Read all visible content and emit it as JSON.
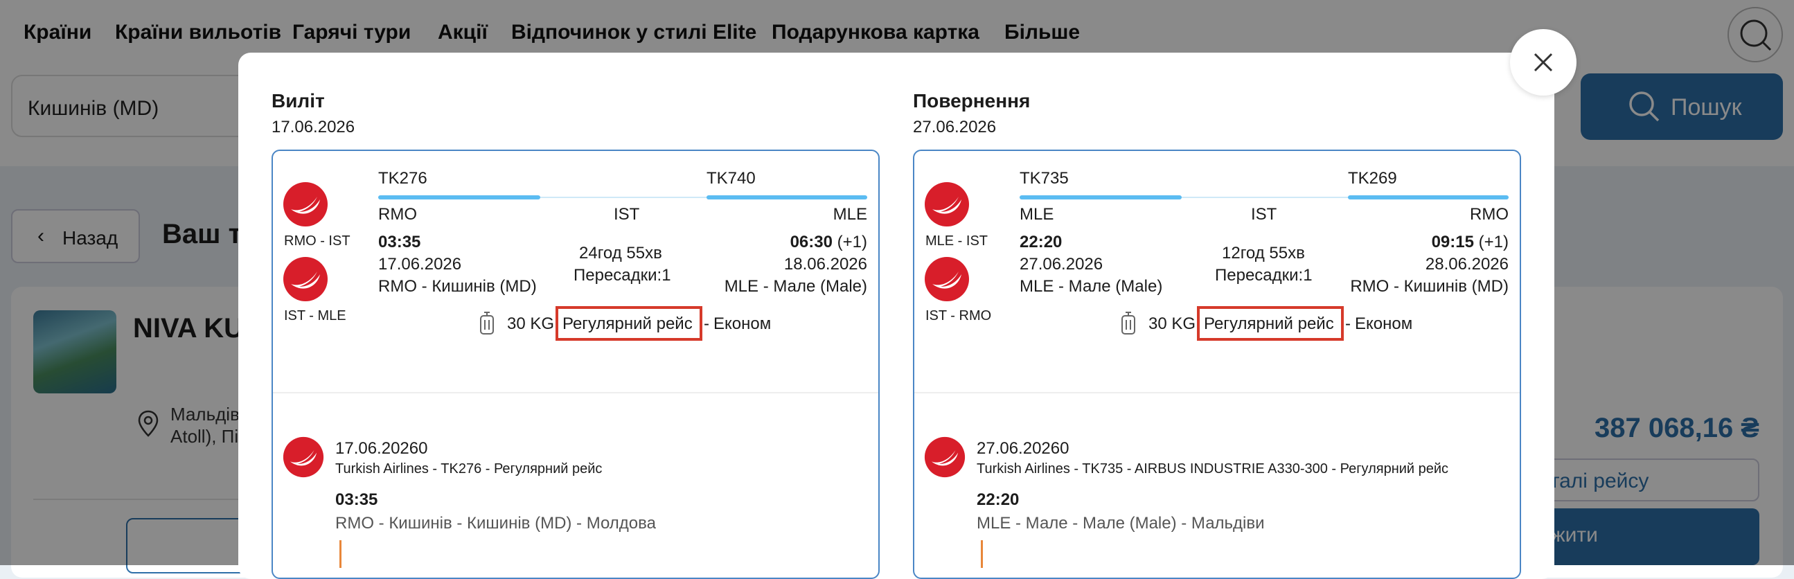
{
  "nav": {
    "items": [
      "Країни",
      "Країни вильотів",
      "Гарячі тури",
      "Акції",
      "Відпочинок у стилі Elite",
      "Подарункова картка",
      "Більше"
    ]
  },
  "search": {
    "from_value": "Кишинів (MD)",
    "button_label": "Пошук"
  },
  "page": {
    "back_label": "Назад",
    "title_partial": "Ваш т",
    "hotel_name_partial": "NIVA KU",
    "location_line1": "Мальдів",
    "location_line2": "Atoll), Пі",
    "price": "387 068,16 ₴",
    "details_button_partial": "еталі рейсу",
    "book_button_partial": "вжити"
  },
  "modal": {
    "departure": {
      "heading": "Виліт",
      "date": "17.06.2026",
      "flight1": "TK276",
      "flight2": "TK740",
      "from": "RMO",
      "via": "IST",
      "to": "MLE",
      "leg1": "RMO - IST",
      "leg2": "IST - MLE",
      "dep_time": "03:35",
      "dep_date": "17.06.2026",
      "dep_place": "RMO - Кишинів (MD)",
      "duration": "24год 55хв",
      "transfers": "Пересадки:1",
      "arr_time": "06:30",
      "arr_plus": "(+1)",
      "arr_date": "18.06.2026",
      "arr_place": "MLE - Мале (Male)",
      "baggage": "30 KG",
      "flight_type": "Регулярний рейс",
      "cabin": "Економ",
      "seg_date": "17.06.20260",
      "seg_desc": "Turkish Airlines - TK276 - Регулярний рейс",
      "seg_time": "03:35",
      "seg_place": "RMO - Кишинів - Кишинів (MD) - Молдова"
    },
    "return": {
      "heading": "Повернення",
      "date": "27.06.2026",
      "flight1": "TK735",
      "flight2": "TK269",
      "from": "MLE",
      "via": "IST",
      "to": "RMO",
      "leg1": "MLE - IST",
      "leg2": "IST - RMO",
      "dep_time": "22:20",
      "dep_date": "27.06.2026",
      "dep_place": "MLE - Мале (Male)",
      "duration": "12год 55хв",
      "transfers": "Пересадки:1",
      "arr_time": "09:15",
      "arr_plus": "(+1)",
      "arr_date": "28.06.2026",
      "arr_place": "RMO - Кишинів (MD)",
      "baggage": "30 KG",
      "flight_type": "Регулярний рейс",
      "cabin": "Економ",
      "seg_date": "27.06.20260",
      "seg_desc": "Turkish Airlines - TK735 - AIRBUS INDUSTRIE A330-300 - Регулярний рейс",
      "seg_time": "22:20",
      "seg_place": "MLE - Мале - Мале (Male) - Мальдіви"
    }
  },
  "colors": {
    "accent": "#2e6fa8",
    "route_bar": "#5bbcf2",
    "highlight": "#d63a2a",
    "airline_red": "#d81e2a"
  }
}
